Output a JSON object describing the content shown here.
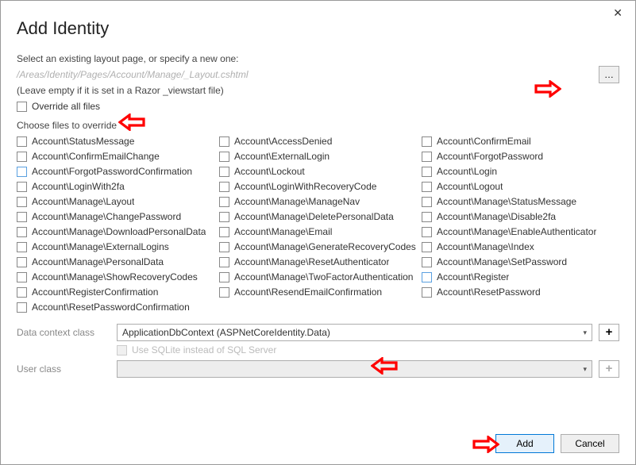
{
  "title": "Add Identity",
  "hint": "Select an existing layout page, or specify a new one:",
  "layout_path": "/Areas/Identity/Pages/Account/Manage/_Layout.cshtml",
  "sub_hint": "(Leave empty if it is set in a Razor _viewstart file)",
  "browse_label": "…",
  "override_all_label": "Override all files",
  "choose_label": "Choose files to override",
  "files_col1_labels": [
    "Account\\StatusMessage",
    "Account\\ConfirmEmailChange",
    "Account\\ForgotPasswordConfirmation",
    "Account\\LoginWith2fa",
    "Account\\Manage\\Layout",
    "Account\\Manage\\ChangePassword",
    "Account\\Manage\\DownloadPersonalData",
    "Account\\Manage\\ExternalLogins",
    "Account\\Manage\\PersonalData",
    "Account\\Manage\\ShowRecoveryCodes",
    "Account\\RegisterConfirmation",
    "Account\\ResetPasswordConfirmation"
  ],
  "files_col2_labels": [
    "Account\\AccessDenied",
    "Account\\ExternalLogin",
    "Account\\Lockout",
    "Account\\LoginWithRecoveryCode",
    "Account\\Manage\\ManageNav",
    "Account\\Manage\\DeletePersonalData",
    "Account\\Manage\\Email",
    "Account\\Manage\\GenerateRecoveryCodes",
    "Account\\Manage\\ResetAuthenticator",
    "Account\\Manage\\TwoFactorAuthentication",
    "Account\\ResendEmailConfirmation",
    ""
  ],
  "files_col3_labels": [
    "Account\\ConfirmEmail",
    "Account\\ForgotPassword",
    "Account\\Login",
    "Account\\Logout",
    "Account\\Manage\\StatusMessage",
    "Account\\Manage\\Disable2fa",
    "Account\\Manage\\EnableAuthenticator",
    "Account\\Manage\\Index",
    "Account\\Manage\\SetPassword",
    "Account\\Register",
    "Account\\ResetPassword",
    ""
  ],
  "data_context_label": "Data context class",
  "data_context_value": "ApplicationDbContext (ASPNetCoreIdentity.Data)",
  "sqlite_label": "Use SQLite instead of SQL Server",
  "user_class_label": "User class",
  "user_class_value": "",
  "plus_label": "+",
  "add_label": "Add",
  "cancel_label": "Cancel"
}
